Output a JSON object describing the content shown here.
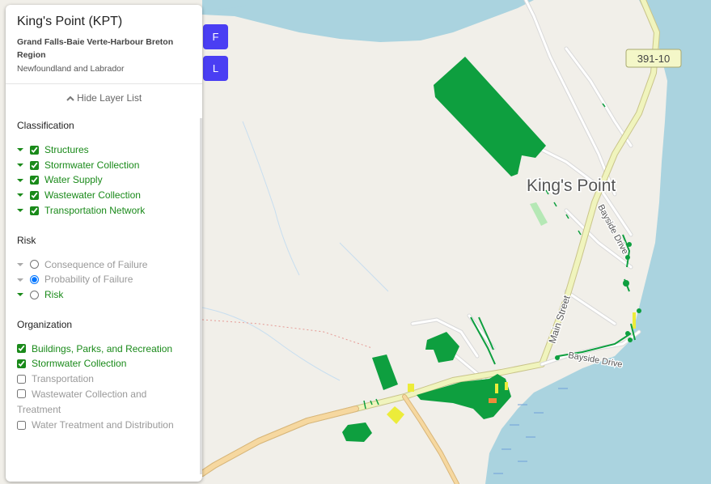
{
  "map": {
    "town_label": "King's Point",
    "route_shield": "391-10",
    "street_main": "Main Street",
    "street_bayside_1": "Bayside Drive",
    "street_bayside_2": "Bayside Drive",
    "colors": {
      "water": "#aad3df",
      "land": "#f1efe9",
      "asset_green": "#0e9f3f",
      "road_yellow": "#f0f4bd",
      "road_tan": "#f6d8a0"
    }
  },
  "panel": {
    "title": "King's Point (KPT)",
    "region_line1": "Grand Falls-Baie Verte-Harbour Breton",
    "region_line2": "Region",
    "province": "Newfoundland and Labrador",
    "toggle_label": "Hide Layer List",
    "sections": {
      "classification": {
        "heading": "Classification",
        "items": [
          {
            "label": "Structures",
            "checked": true
          },
          {
            "label": "Stormwater Collection",
            "checked": true
          },
          {
            "label": "Water Supply",
            "checked": true
          },
          {
            "label": "Wastewater Collection",
            "checked": true
          },
          {
            "label": "Transportation Network",
            "checked": true
          }
        ]
      },
      "risk": {
        "heading": "Risk",
        "items": [
          {
            "label": "Consequence of Failure",
            "selected": false
          },
          {
            "label": "Probability of Failure",
            "selected": true
          },
          {
            "label": "Risk",
            "selected": false
          }
        ]
      },
      "organization": {
        "heading": "Organization",
        "items": [
          {
            "label": "Buildings, Parks, and Recreation",
            "checked": true
          },
          {
            "label": "Stormwater Collection",
            "checked": true
          },
          {
            "label": "Transportation",
            "checked": false
          },
          {
            "label": "Wastewater Collection and Treatment",
            "checked": false
          },
          {
            "label": "Water Treatment and Distribution",
            "checked": false
          }
        ]
      }
    }
  },
  "buttons": {
    "f_label": "F",
    "l_label": "L"
  }
}
